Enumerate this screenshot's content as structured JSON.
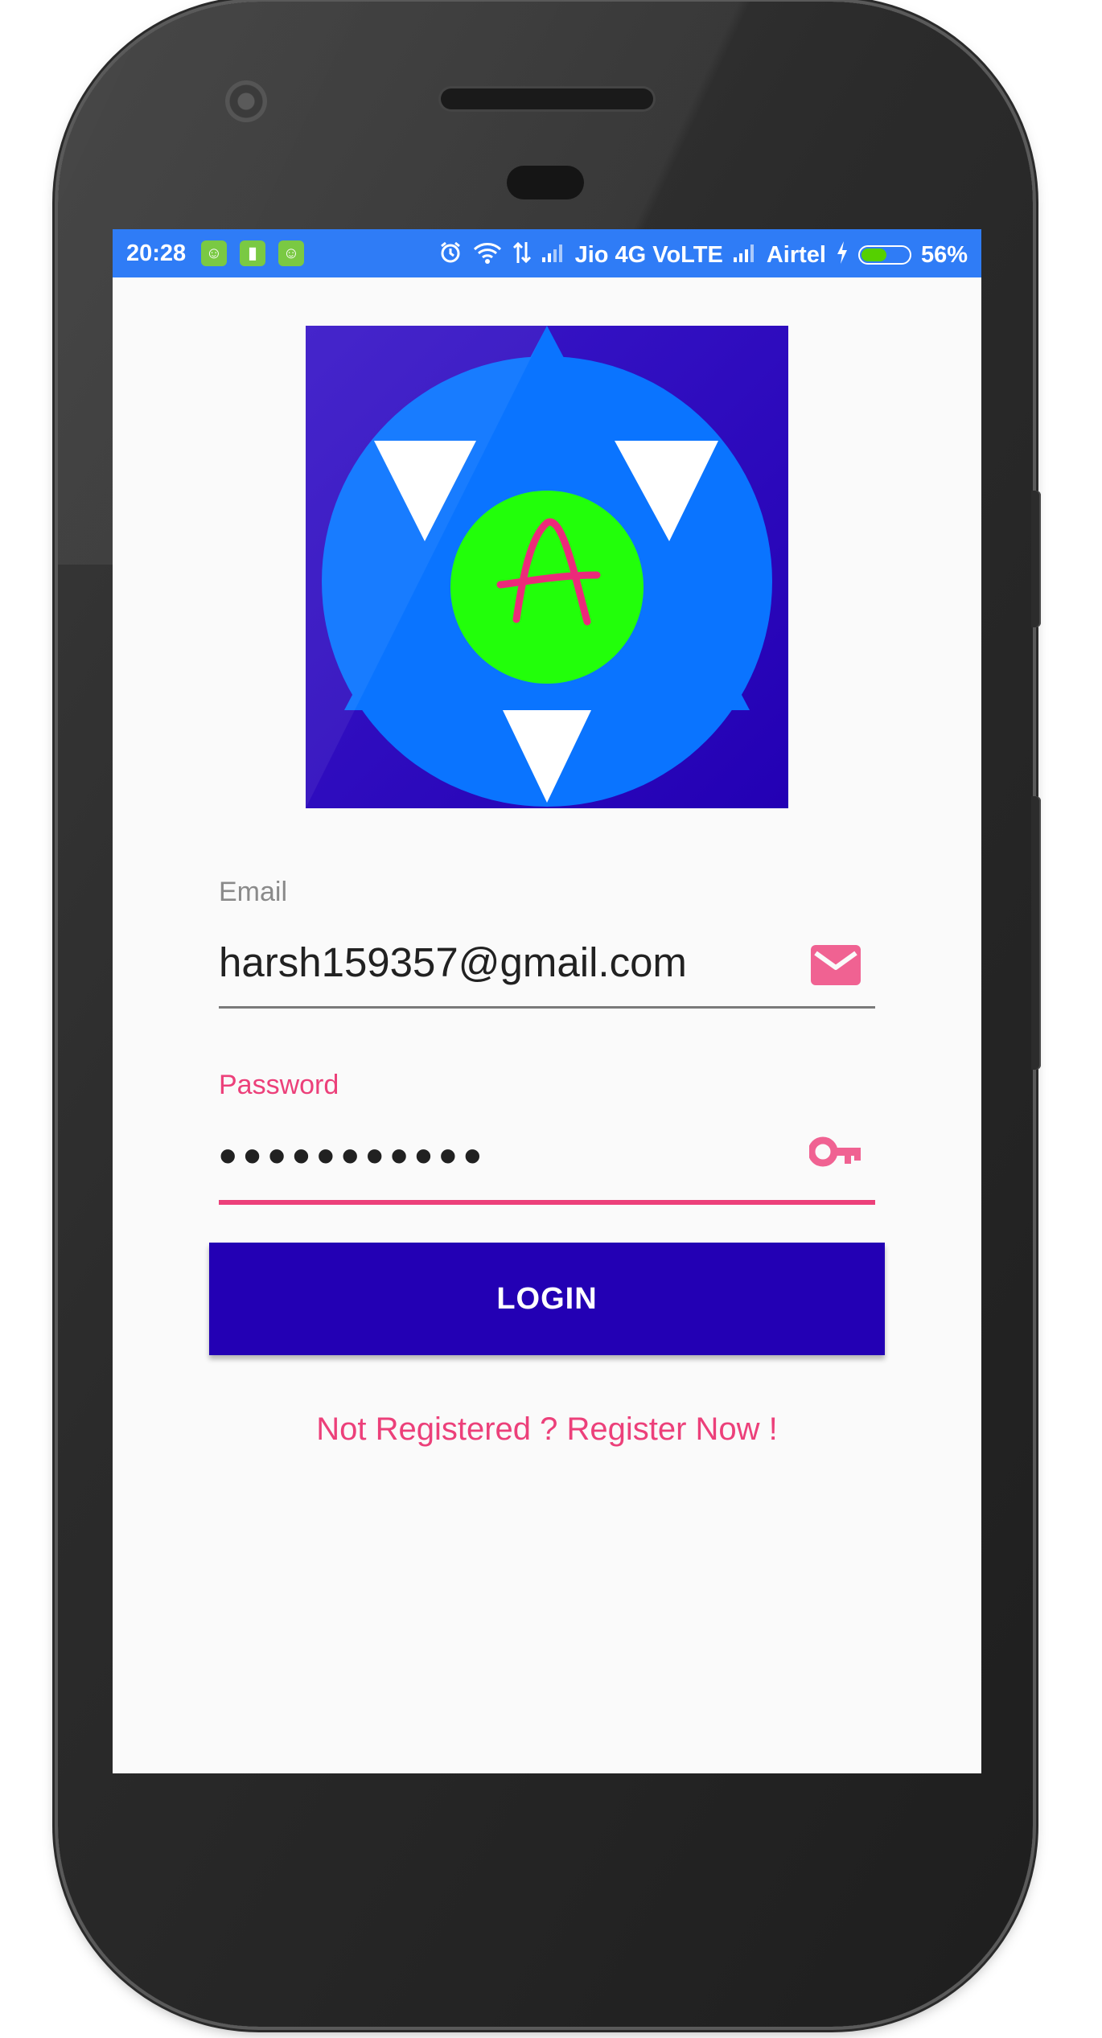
{
  "status_bar": {
    "time": "20:28",
    "carrier_1": "Jio 4G VoLTE",
    "carrier_2": "Airtel",
    "battery_percent_text": "56%",
    "battery_level": 0.56,
    "icons": [
      "notification-cat-icon",
      "notification-battery-icon",
      "notification-cat-icon",
      "alarm-icon",
      "wifi-icon",
      "data-transfer-icon",
      "signal-icon",
      "signal-icon",
      "charging-icon",
      "battery-icon"
    ],
    "bar_color": "#2f7cf6"
  },
  "logo": {
    "letter": "A",
    "background_color": "#2300b4",
    "circle_color": "#0a74ff",
    "center_color": "#22ff0a",
    "letter_color": "#ec2a7a"
  },
  "login_form": {
    "email_label": "Email",
    "email_value": "harsh159357@gmail.com",
    "email_icon": "mail-icon",
    "password_label": "Password",
    "password_value": "•••••••••••",
    "password_icon": "key-icon",
    "login_button": "LOGIN",
    "register_link": "Not Registered ? Register Now !"
  },
  "colors": {
    "accent": "#ec407a",
    "primary": "#2300b4",
    "screen_background": "#fafafa"
  }
}
